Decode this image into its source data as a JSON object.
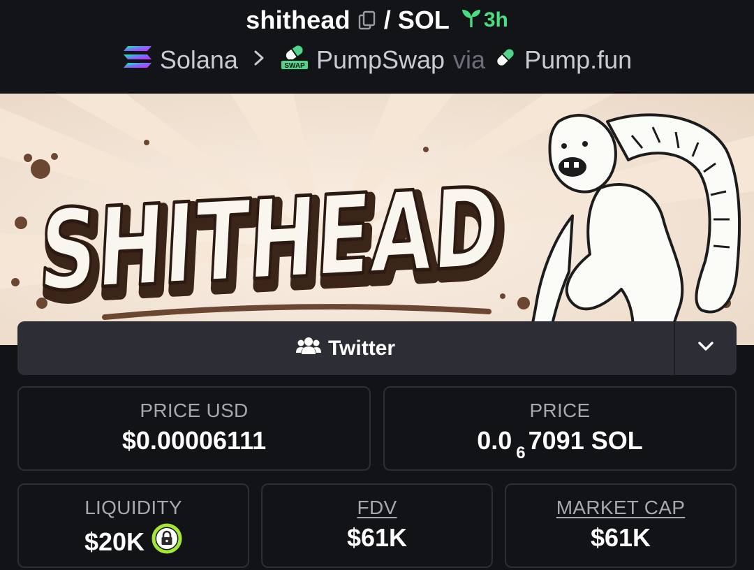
{
  "header": {
    "token_name": "shithead",
    "separator": "/",
    "quote": "SOL",
    "age": "3h",
    "icons": [
      "copy-icon",
      "seedling-icon"
    ]
  },
  "chain_row": {
    "chain": "Solana",
    "dex": "PumpSwap",
    "via": "via",
    "launchpad": "Pump.fun",
    "dex_badge": "SWAP",
    "icons": [
      "solana-logo-icon",
      "chevron-right-icon",
      "pumpswap-logo-icon",
      "pill-icon"
    ]
  },
  "banner": {
    "text": "SHITHEAD"
  },
  "social": {
    "label": "Twitter",
    "icons": [
      "users-icon",
      "chevron-down-icon"
    ]
  },
  "stats": {
    "price_usd": {
      "label": "PRICE USD",
      "value": "$0.00006111"
    },
    "price_native": {
      "label": "PRICE",
      "prefix": "0.0",
      "zeros": "6",
      "digits": "7091",
      "unit": "SOL"
    },
    "liquidity": {
      "label": "LIQUIDITY",
      "value": "$20K",
      "icon": "lock-icon"
    },
    "fdv": {
      "label": "FDV",
      "value": "$61K"
    },
    "market_cap": {
      "label": "MARKET CAP",
      "value": "$61K"
    }
  },
  "colors": {
    "background": "#121317",
    "card_border": "#2d2f36",
    "accent_green": "#4ade80",
    "lock_green": "#a3e635",
    "button_bg": "#2d2e35"
  }
}
